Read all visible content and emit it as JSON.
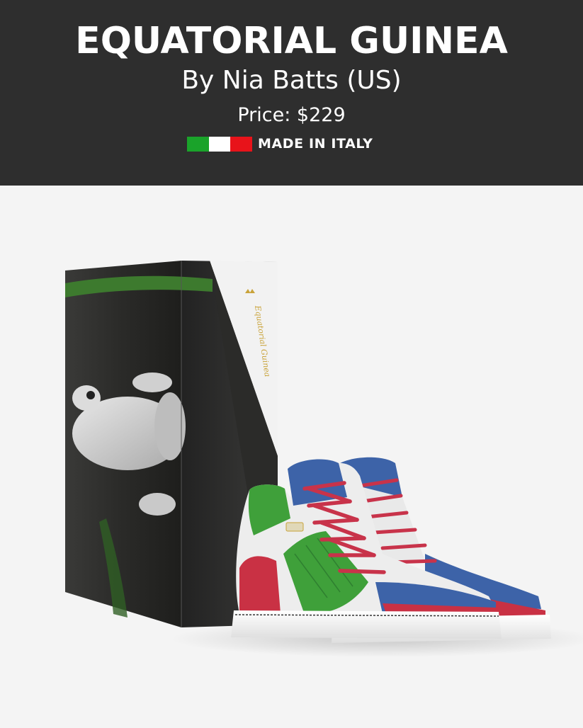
{
  "product": {
    "title": "EQUATORIAL GUINEA",
    "byline": "By Nia Batts (US)",
    "price": "Price: $229",
    "origin": "MADE IN ITALY",
    "origin_flag_colors": [
      "#1aa32a",
      "#ffffff",
      "#e8131a"
    ]
  },
  "colors": {
    "header_bg": "#2e2e2e",
    "page_bg": "#f4f4f4",
    "shoe_blue": "#3d63a8",
    "shoe_green": "#3fa03a",
    "shoe_red": "#c93144",
    "laces": "#c8334a",
    "box_label_gold": "#c9a33a"
  },
  "box_label": {
    "name": "Equatorial Guinea"
  },
  "icons": {
    "flag": "italy-flag-icon",
    "crown": "crown-icon"
  }
}
